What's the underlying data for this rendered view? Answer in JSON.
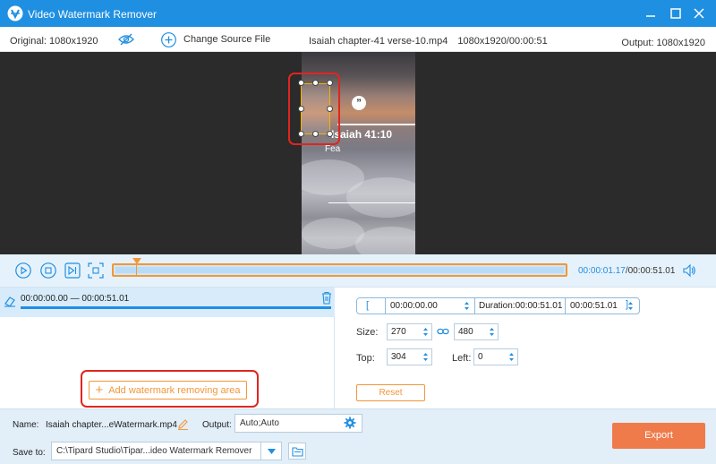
{
  "window": {
    "title": "Video Watermark Remover",
    "icons": [
      "app-logo-icon",
      "minimize-icon",
      "maximize-icon",
      "close-icon"
    ]
  },
  "infobar": {
    "original": "Original: 1080x1920",
    "change_source": "Change Source File",
    "file_name": "Isaiah chapter-41 verse-10.mp4",
    "file_meta": "1080x1920/00:00:51",
    "output": "Output: 1080x1920"
  },
  "video_overlay": {
    "quote_mark": "”",
    "caption": "Isaiah 41:10",
    "caption2": "Fea"
  },
  "timeline": {
    "current": "00:00:01.17",
    "total": "/00:00:51.01",
    "progress_fraction": 0.023
  },
  "segment": {
    "range": "00:00:00.00 — 00:00:51.01"
  },
  "add_area_label": "Add watermark removing area",
  "range_editor": {
    "open_bracket": "[",
    "start": "00:00:00.00",
    "duration": "Duration:00:00:51.01",
    "end": "00:00:51.01",
    "close_bracket": "]"
  },
  "size": {
    "label": "Size:",
    "width": "270",
    "height": "480"
  },
  "position": {
    "top_label": "Top:",
    "top": "304",
    "left_label": "Left:",
    "left": "0"
  },
  "reset_label": "Reset",
  "footer": {
    "name_label": "Name:",
    "name_value": "Isaiah chapter...eWatermark.mp4",
    "output_label": "Output:",
    "output_value": "Auto;Auto",
    "save_label": "Save to:",
    "save_path": "C:\\Tipard Studio\\Tipar...ideo Watermark Remover",
    "export_label": "Export"
  },
  "colors": {
    "accent": "#1f8fe1",
    "orange": "#f39638",
    "export": "#f07b4a",
    "highlight": "#e0251f"
  }
}
